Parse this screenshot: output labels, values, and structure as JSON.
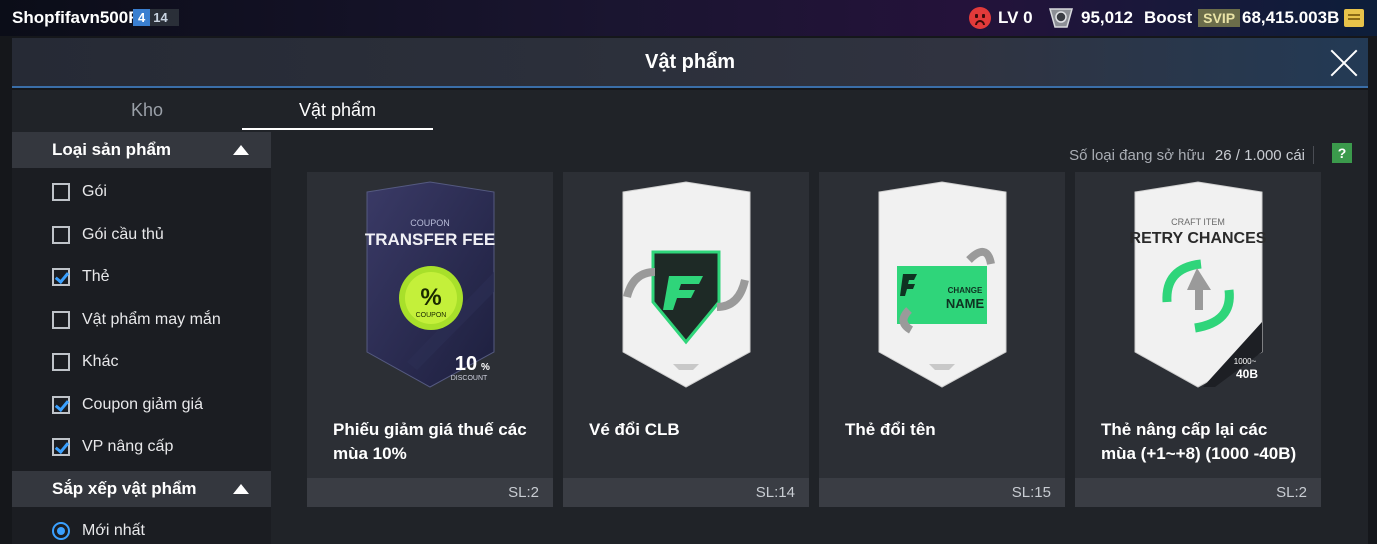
{
  "topbar": {
    "username": "Shopfifavn500R",
    "badge_primary": "4",
    "badge_secondary": "14",
    "level": "LV 0",
    "coins": "95,012",
    "boost_label": "Boost",
    "svip_label": "SVIP",
    "bc": "68,415.003B"
  },
  "panel": {
    "title": "Vật phẩm"
  },
  "tabs": [
    {
      "label": "Kho",
      "active": false
    },
    {
      "label": "Vật phẩm",
      "active": true
    }
  ],
  "sidebar": {
    "filter_title": "Loại sản phẩm",
    "filters": [
      {
        "label": "Gói",
        "checked": false
      },
      {
        "label": "Gói cầu thủ",
        "checked": false
      },
      {
        "label": "Thẻ",
        "checked": true
      },
      {
        "label": "Vật phẩm may mắn",
        "checked": false
      },
      {
        "label": "Khác",
        "checked": false
      },
      {
        "label": "Coupon giảm giá",
        "checked": true
      },
      {
        "label": "VP nâng cấp",
        "checked": true
      }
    ],
    "sort_title": "Sắp xếp vật phẩm",
    "sort_selected": "Mới nhất"
  },
  "main": {
    "owned_label": "Số loại đang sở hữu",
    "owned_value": "26 / 1.000 cái",
    "help_label": "?"
  },
  "items": [
    {
      "name": "Phiếu giảm giá thuế các mùa 10%",
      "qty": "SL:2",
      "art": {
        "kind": "coupon",
        "top_text": "COUPON",
        "title": "TRANSFER FEE",
        "badge": "%",
        "badge_sub": "COUPON",
        "value": "10",
        "value_unit": "%",
        "value_sub": "DISCOUNT"
      }
    },
    {
      "name": "Vé đổi CLB",
      "qty": "SL:14",
      "art": {
        "kind": "club"
      }
    },
    {
      "name": "Thẻ đổi tên",
      "qty": "SL:15",
      "art": {
        "kind": "rename",
        "line1": "CHANGE",
        "line2": "NAME"
      }
    },
    {
      "name": "Thẻ nâng cấp lại các mùa (+1~+8) (1000 -40B)",
      "qty": "SL:2",
      "art": {
        "kind": "retry",
        "top_text": "CRAFT ITEM",
        "title": "RETRY CHANCES",
        "corner1": "1000~",
        "corner2": "40B"
      }
    }
  ],
  "colors": {
    "accent": "#3aa0ff",
    "green": "#2fd57a",
    "panel": "#202328"
  }
}
